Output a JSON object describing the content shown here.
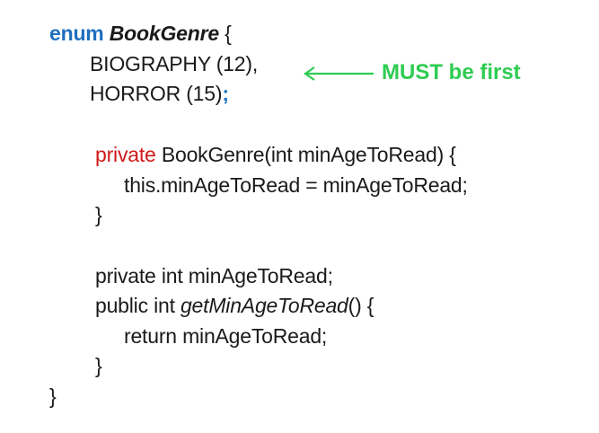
{
  "code": {
    "line1": {
      "kw": "enum",
      "name": "BookGenre",
      "rest": " {"
    },
    "line2": "BIOGRAPHY (12),",
    "line3": {
      "text": "HORROR (15)",
      "semi": ";"
    },
    "line4": {
      "kw": "private",
      "rest": " BookGenre(int minAgeToRead) {"
    },
    "line5": "this.minAgeToRead = minAgeToRead;",
    "line6": "}",
    "line7": "private int minAgeToRead;",
    "line8": {
      "pre": "public int ",
      "method": "getMinAgeToRead",
      "post": "() {"
    },
    "line9": "return minAgeToRead;",
    "line10": "}",
    "line11": "}"
  },
  "annotation": {
    "text": "MUST be first",
    "color": "#2ecc52"
  },
  "colors": {
    "enum_keyword": "#1f6fbf",
    "private_keyword": "#d01a1a",
    "semicolon": "#1f6fbf"
  }
}
